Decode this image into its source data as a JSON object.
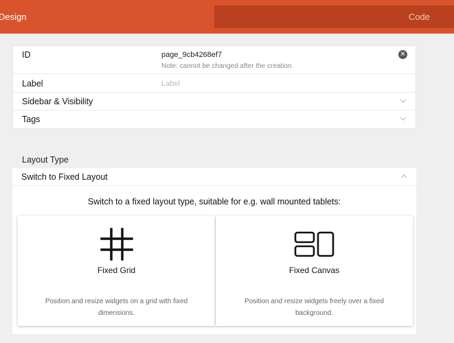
{
  "tabs": {
    "design_label": "Design",
    "code_label": "Code"
  },
  "form": {
    "id": {
      "label": "ID",
      "value": "page_9cb4268ef7",
      "note": "Note: cannot be changed after the creation"
    },
    "label_field": {
      "label": "Label",
      "placeholder": "Label",
      "value": ""
    },
    "sidebar_visibility": {
      "label": "Sidebar & Visibility"
    },
    "tags": {
      "label": "Tags"
    }
  },
  "layout": {
    "section_title": "Layout Type",
    "switch_label": "Switch to Fixed Layout",
    "description": "Switch to a fixed layout type, suitable for e.g. wall mounted tablets:",
    "options": [
      {
        "icon": "grid-icon",
        "title": "Fixed Grid",
        "text": "Position and resize widgets on a grid with fixed dimensions."
      },
      {
        "icon": "canvas-icon",
        "title": "Fixed Canvas",
        "text": "Position and resize widgets freely over a fixed background."
      }
    ]
  },
  "colors": {
    "accent": "#d9542c",
    "accent_dark": "#b9411f",
    "background": "#efefef"
  }
}
